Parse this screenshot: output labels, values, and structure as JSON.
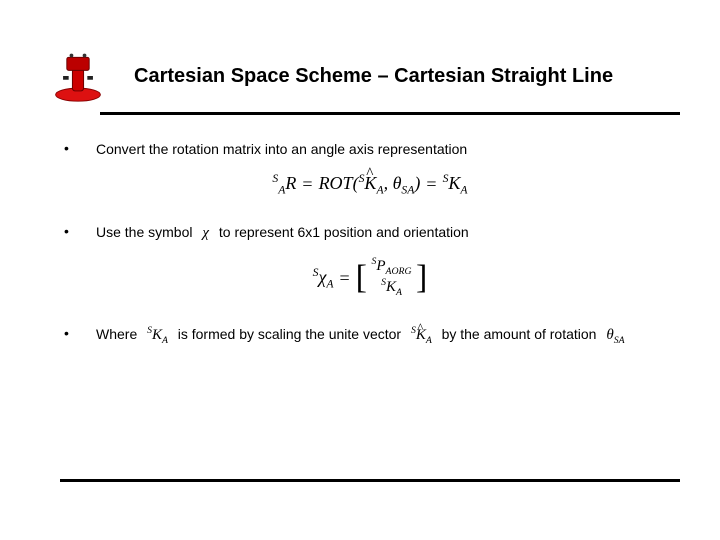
{
  "title": "Cartesian Space Scheme – Cartesian Straight Line",
  "bullets": {
    "b1": "Convert the rotation matrix into an angle axis representation",
    "b2_pre": "Use the symbol",
    "b2_post": "to represent 6x1 position and orientation",
    "b3_pre": "Where",
    "b3_mid": "is formed by scaling the unite vector",
    "b3_post": "by the amount of rotation"
  },
  "math": {
    "chi": "χ",
    "eq1_lhs_pre": "S",
    "eq1_lhs_sub": "A",
    "eq1_lhs_R": "R",
    "eq1_rot": "ROT",
    "eq1_k_pre": "S",
    "eq1_k_hat": "K",
    "eq1_k_sub": "A",
    "eq1_theta": "θ",
    "eq1_theta_sub": "SA",
    "eq1_rhs_pre": "S",
    "eq1_rhs_K": "K",
    "eq1_rhs_sub": "A",
    "eq2_lhs_pre": "S",
    "eq2_chi": "χ",
    "eq2_chi_sub": "A",
    "eq2_p_pre": "S",
    "eq2_P": "P",
    "eq2_P_sub": "AORG",
    "eq2_k_pre": "S",
    "eq2_K": "K",
    "eq2_K_sub": "A",
    "b3_sk_pre": "S",
    "b3_sk_K": "K",
    "b3_sk_sub": "A",
    "b3_khat_pre": "S",
    "b3_khat_K": "K",
    "b3_khat_sub": "A",
    "b3_theta": "θ",
    "b3_theta_sub": "SA"
  }
}
